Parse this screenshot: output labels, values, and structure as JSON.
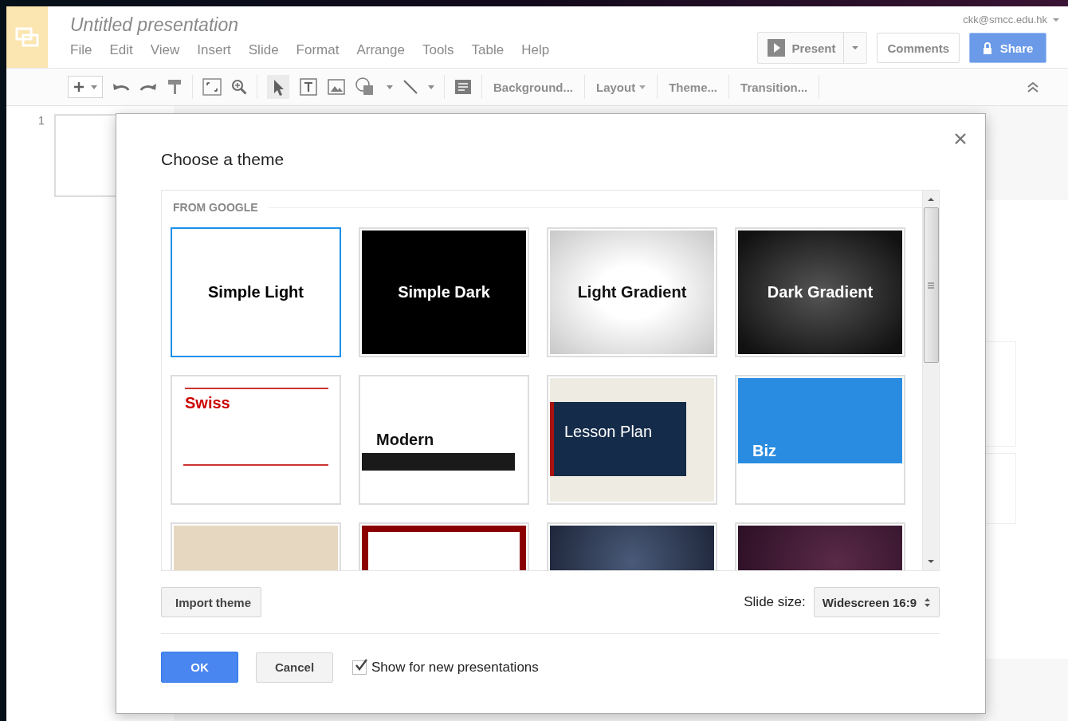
{
  "app": {
    "title": "Untitled presentation",
    "menu": [
      "File",
      "Edit",
      "View",
      "Insert",
      "Slide",
      "Format",
      "Arrange",
      "Tools",
      "Table",
      "Help"
    ],
    "account": "ckk@smcc.edu.hk",
    "present": "Present",
    "comments": "Comments",
    "share": "Share"
  },
  "toolbar": {
    "buttons": [
      {
        "label": "Background...",
        "kind": "plain"
      },
      {
        "label": "Layout",
        "kind": "dropdown"
      },
      {
        "label": "Theme...",
        "kind": "plain"
      },
      {
        "label": "Transition...",
        "kind": "plain"
      }
    ]
  },
  "filmstrip": {
    "slides": [
      {
        "number": "1"
      }
    ]
  },
  "dialog": {
    "title": "Choose a theme",
    "section": "FROM GOOGLE",
    "themes": [
      {
        "name": "Simple Light",
        "kind": "simple-light",
        "selected": true
      },
      {
        "name": "Simple Dark",
        "kind": "simple-dark",
        "selected": false
      },
      {
        "name": "Light Gradient",
        "kind": "light-gradient",
        "selected": false
      },
      {
        "name": "Dark Gradient",
        "kind": "dark-gradient",
        "selected": false
      },
      {
        "name": "Swiss",
        "kind": "swiss",
        "selected": false
      },
      {
        "name": "Modern",
        "kind": "modern",
        "selected": false
      },
      {
        "name": "Lesson Plan",
        "kind": "lesson-plan",
        "selected": false
      },
      {
        "name": "Biz",
        "kind": "biz",
        "selected": false
      },
      {
        "kind": "beige",
        "selected": false
      },
      {
        "kind": "red-frame",
        "selected": false
      },
      {
        "kind": "blue-stage",
        "selected": false
      },
      {
        "kind": "purple",
        "selected": false
      }
    ],
    "import_button": "Import theme",
    "slide_size": {
      "label": "Slide size:",
      "value": "Widescreen 16:9"
    },
    "ok": "OK",
    "cancel": "Cancel",
    "show_for_new": {
      "label": "Show for new presentations",
      "checked": true
    }
  }
}
